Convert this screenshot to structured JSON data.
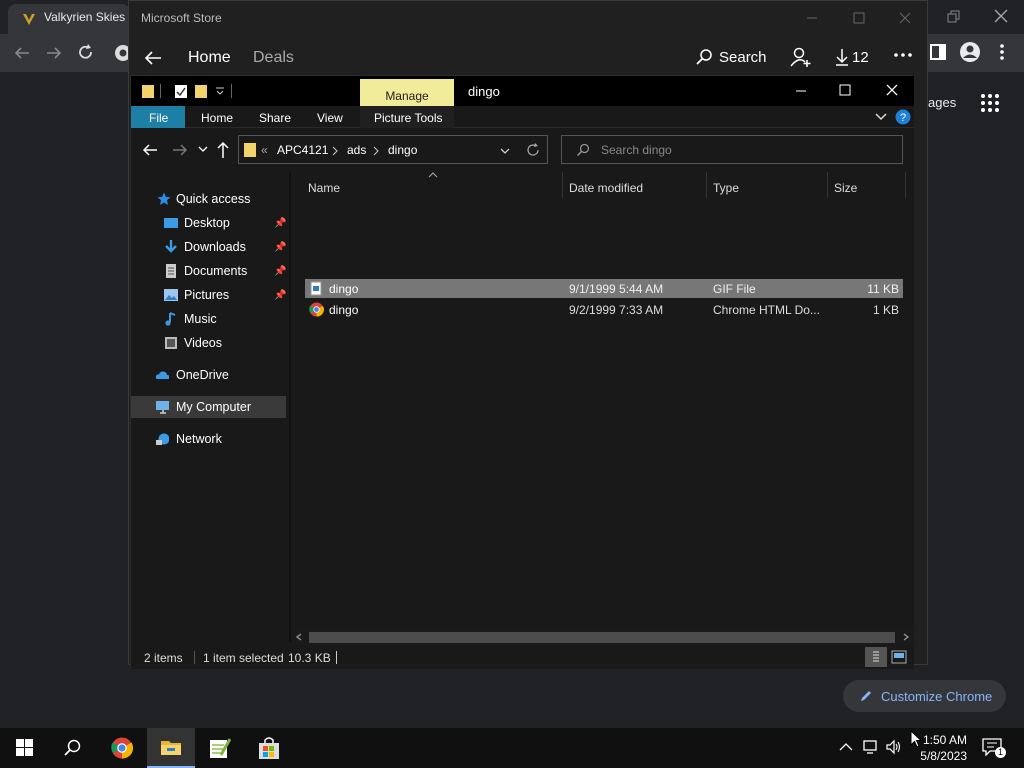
{
  "chrome": {
    "tab_title": "Valkyrien Skies -",
    "images_link": "ages",
    "customize_label": "Customize Chrome"
  },
  "store": {
    "title": "Microsoft Store",
    "nav_home": "Home",
    "nav_deals": "Deals",
    "search_label": "Search",
    "downloads_count": "12"
  },
  "explorer": {
    "context_tab": "Manage",
    "context_group": "Picture Tools",
    "window_title": "dingo",
    "ribbon_tabs": [
      "File",
      "Home",
      "Share",
      "View"
    ],
    "breadcrumb": {
      "overflow": "«",
      "parts": [
        "APC4121",
        "ads",
        "dingo"
      ]
    },
    "search_placeholder": "Search dingo",
    "nav": {
      "quick_access": "Quick access",
      "desktop": "Desktop",
      "downloads": "Downloads",
      "documents": "Documents",
      "pictures": "Pictures",
      "music": "Music",
      "videos": "Videos",
      "onedrive": "OneDrive",
      "my_computer": "My Computer",
      "network": "Network"
    },
    "columns": [
      "Name",
      "Date modified",
      "Type",
      "Size"
    ],
    "files": [
      {
        "name": "dingo",
        "date": "9/1/1999 5:44 AM",
        "type": "GIF File",
        "size": "11 KB",
        "icon": "gif-file-icon",
        "selected": true
      },
      {
        "name": "dingo",
        "date": "9/2/1999 7:33 AM",
        "type": "Chrome HTML Do...",
        "size": "1 KB",
        "icon": "chrome-html-icon",
        "selected": false
      }
    ],
    "status": {
      "items": "2 items",
      "selected": "1 item selected",
      "size": "10.3 KB"
    }
  },
  "taskbar": {
    "time": "1:50 AM",
    "date": "5/8/2023",
    "notification_count": "1"
  },
  "colors": {
    "file_tab": "#1e7fa6",
    "manage_tab": "#f1ec9a",
    "selected_row": "#777777",
    "link_blue": "#8ab4f8"
  }
}
